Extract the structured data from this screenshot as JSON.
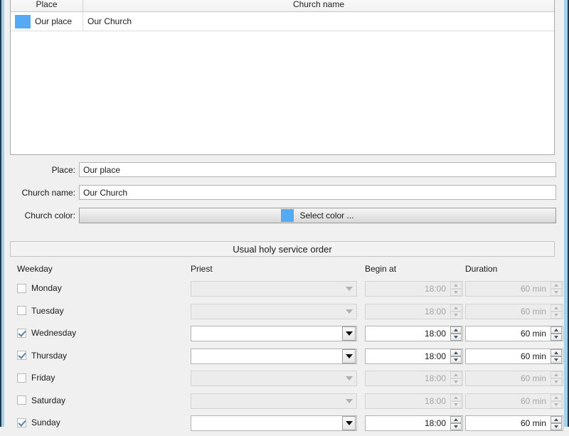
{
  "colors": {
    "church_color": "#55aaf5",
    "window_frame": "#a8cfe8"
  },
  "places_table": {
    "columns": [
      "Place",
      "Church name"
    ],
    "rows": [
      {
        "swatch": "#55aaf5",
        "place": "Our place",
        "church_name": "Our Church"
      }
    ]
  },
  "form": {
    "place_label": "Place:",
    "place_value": "Our place",
    "church_name_label": "Church name:",
    "church_name_value": "Our Church",
    "church_color_label": "Church color:",
    "select_color_label": "Select color ..."
  },
  "schedule": {
    "section_title": "Usual holy service order",
    "columns": {
      "weekday": "Weekday",
      "priest": "Priest",
      "begin_at": "Begin at",
      "duration": "Duration"
    },
    "rows": [
      {
        "weekday": "Monday",
        "checked": false,
        "priest": "",
        "begin_at": "18:00",
        "duration": "60 min"
      },
      {
        "weekday": "Tuesday",
        "checked": false,
        "priest": "",
        "begin_at": "18:00",
        "duration": "60 min"
      },
      {
        "weekday": "Wednesday",
        "checked": true,
        "priest": "",
        "begin_at": "18:00",
        "duration": "60 min"
      },
      {
        "weekday": "Thursday",
        "checked": true,
        "priest": "",
        "begin_at": "18:00",
        "duration": "60 min"
      },
      {
        "weekday": "Friday",
        "checked": false,
        "priest": "",
        "begin_at": "18:00",
        "duration": "60 min"
      },
      {
        "weekday": "Saturday",
        "checked": false,
        "priest": "",
        "begin_at": "18:00",
        "duration": "60 min"
      },
      {
        "weekday": "Sunday",
        "checked": true,
        "priest": "",
        "begin_at": "18:00",
        "duration": "60 min"
      }
    ]
  }
}
